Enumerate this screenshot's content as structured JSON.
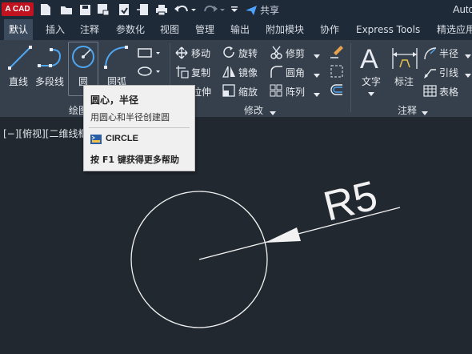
{
  "titlebar": {
    "logo": "A CAD",
    "share_label": "共享",
    "app_title": "Auto"
  },
  "tabs": [
    "默认",
    "插入",
    "注释",
    "参数化",
    "视图",
    "管理",
    "输出",
    "附加模块",
    "协作",
    "Express Tools",
    "精选应用"
  ],
  "ribbon": {
    "draw": {
      "line": "直线",
      "polyline": "多段线",
      "circle": "圆",
      "arc": "圆弧",
      "panel_title": "绘图"
    },
    "modify": {
      "move": "移动",
      "rotate": "旋转",
      "trim": "修剪",
      "copy": "复制",
      "mirror": "镜像",
      "fillet": "圆角",
      "stretch": "拉伸",
      "scale": "缩放",
      "array": "阵列",
      "panel_title": "修改"
    },
    "annotation": {
      "text": "文字",
      "dimension": "标注",
      "radius": "半径",
      "leader": "引线",
      "table": "表格",
      "panel_title": "注释"
    }
  },
  "viewport": {
    "label": "[−][俯视][二维线框]"
  },
  "drawing": {
    "dimension_text": "R5"
  },
  "tooltip": {
    "title": "圆心，半径",
    "description": "用圆心和半径创建圆",
    "command": "CIRCLE",
    "help": "按 F1 键获得更多帮助"
  }
}
